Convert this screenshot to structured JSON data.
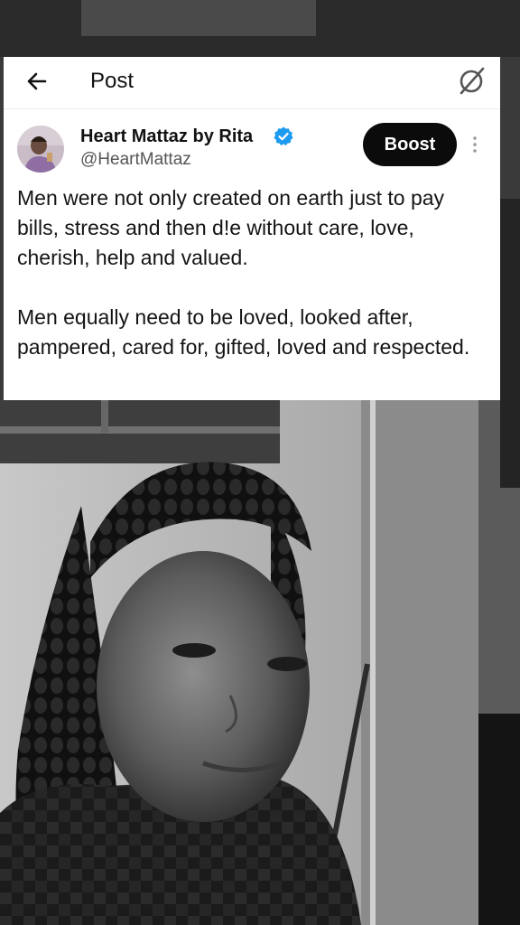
{
  "header": {
    "title": "Post",
    "back_icon": "back-arrow-icon",
    "right_icon": "slash-circle-icon"
  },
  "post": {
    "author_name": "Heart Mattaz by Rita",
    "handle": "@HeartMattaz",
    "verified_icon": "verified-badge-icon",
    "boost_label": "Boost",
    "more_icon": "more-vertical-icon",
    "paragraphs": [
      "Men were not only created on earth just to pay bills, stress and then d!e without care, love, cherish, help and valued.",
      "Men equally need to be loved, looked after, pampered, cared for, gifted, loved and respected."
    ]
  },
  "colors": {
    "card_bg": "#ffffff",
    "verified_blue": "#1d9bf0",
    "boost_bg": "#0b0b0b",
    "video_tone": "grayscale"
  }
}
